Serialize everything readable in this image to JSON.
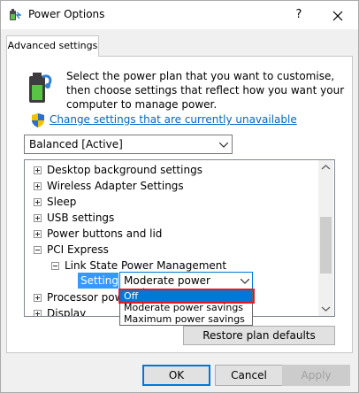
{
  "window": {
    "title": "Power Options",
    "help_label": "?"
  },
  "tabs": [
    {
      "label": "Advanced settings"
    }
  ],
  "content": {
    "description": "Select the power plan that you want to customise, then choose settings that reflect how you want your computer to manage power.",
    "change_link": "Change settings that are currently unavailable",
    "plan_select": {
      "value": "Balanced [Active]"
    }
  },
  "tree": {
    "items": [
      {
        "label": "Desktop background settings",
        "expanded": false
      },
      {
        "label": "Wireless Adapter Settings",
        "expanded": false
      },
      {
        "label": "Sleep",
        "expanded": false
      },
      {
        "label": "USB settings",
        "expanded": false
      },
      {
        "label": "Power buttons and lid",
        "expanded": false
      },
      {
        "label": "PCI Express",
        "expanded": true
      },
      {
        "label": "Link State Power Management",
        "expanded": true
      },
      {
        "label": "Processor power",
        "expanded": false
      },
      {
        "label": "Display",
        "expanded": false
      }
    ],
    "setting": {
      "label": "Setting:",
      "value": "Moderate power savings",
      "options": [
        "Off",
        "Moderate power savings",
        "Maximum power savings"
      ],
      "highlighted_option": "Off"
    }
  },
  "buttons": {
    "restore": "Restore plan defaults",
    "ok": "OK",
    "cancel": "Cancel",
    "apply": "Apply"
  },
  "colors": {
    "link": "#0066cc",
    "selection": "#0078d7",
    "highlight_box": "#e01b24"
  },
  "icons": [
    "power-options-icon",
    "help-icon",
    "close-icon",
    "battery-plan-icon",
    "uac-shield-icon",
    "chevron-down-icon",
    "expand-icon",
    "collapse-icon",
    "scroll-up-icon",
    "scroll-down-icon"
  ]
}
